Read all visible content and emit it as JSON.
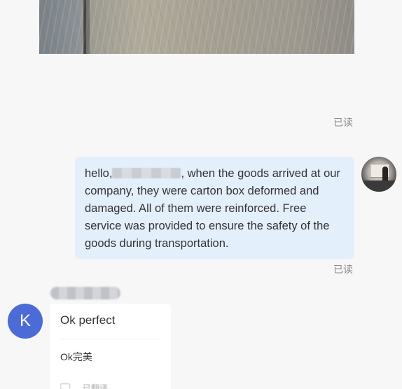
{
  "messages": {
    "image_message": {
      "read_status": "已读"
    },
    "outgoing": {
      "text_before_name": "hello,",
      "text_after_name": ", when the goods arrived at our company, they were carton box deformed and damaged. All of them were reinforced. Free service was provided to ensure the safety of the goods during transportation.",
      "read_status": "已读"
    },
    "incoming": {
      "avatar_initial": "K",
      "text": "Ok perfect",
      "translation": "Ok完美",
      "partial_footer": "…已翻译"
    }
  },
  "colors": {
    "outgoing_bubble": "#e4effc",
    "incoming_bubble": "#ffffff",
    "avatar_k": "#4d6bd6",
    "background": "#f7f7f8",
    "read_status": "#8a8a8a"
  },
  "icons": {
    "read_status": "text",
    "translate": "translate-icon"
  }
}
